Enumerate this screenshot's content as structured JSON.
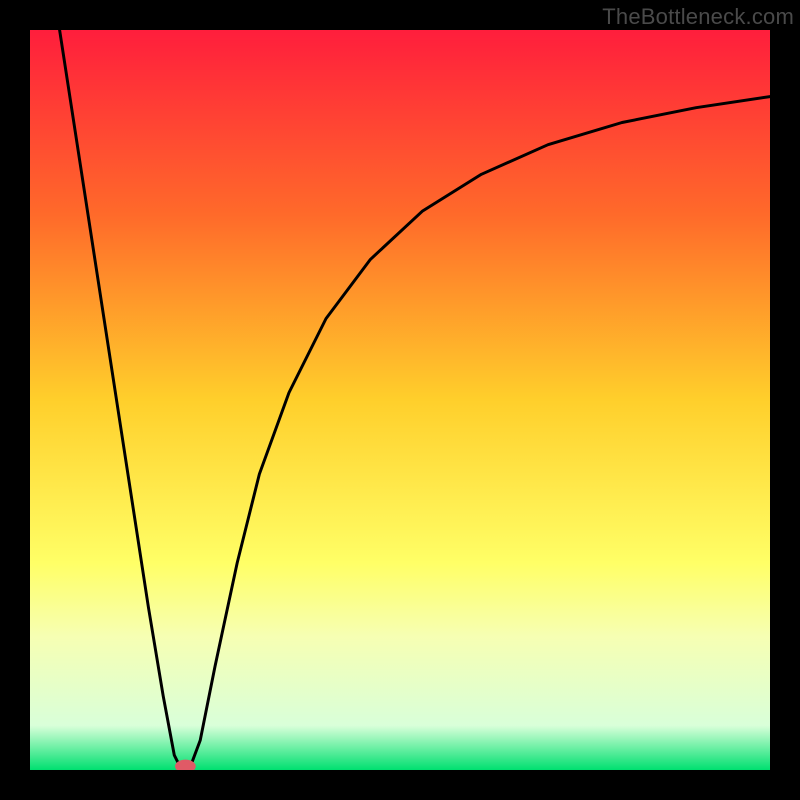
{
  "watermark": "TheBottleneck.com",
  "chart_data": {
    "type": "line",
    "title": "",
    "xlabel": "",
    "ylabel": "",
    "xlim": [
      0,
      100
    ],
    "ylim": [
      0,
      100
    ],
    "gradient_stops": [
      {
        "offset": 0.0,
        "color": "#ff1e3c"
      },
      {
        "offset": 0.25,
        "color": "#ff6a2a"
      },
      {
        "offset": 0.5,
        "color": "#ffcf2b"
      },
      {
        "offset": 0.72,
        "color": "#ffff66"
      },
      {
        "offset": 0.82,
        "color": "#f6ffb3"
      },
      {
        "offset": 0.94,
        "color": "#d9ffd9"
      },
      {
        "offset": 1.0,
        "color": "#00e070"
      }
    ],
    "curve": [
      {
        "x": 4.0,
        "y": 100.0
      },
      {
        "x": 6.0,
        "y": 87.0
      },
      {
        "x": 8.0,
        "y": 74.0
      },
      {
        "x": 10.0,
        "y": 61.0
      },
      {
        "x": 12.0,
        "y": 48.0
      },
      {
        "x": 14.0,
        "y": 35.0
      },
      {
        "x": 16.0,
        "y": 22.0
      },
      {
        "x": 18.0,
        "y": 10.0
      },
      {
        "x": 19.5,
        "y": 2.0
      },
      {
        "x": 20.5,
        "y": 0.0
      },
      {
        "x": 21.5,
        "y": 0.0
      },
      {
        "x": 23.0,
        "y": 4.0
      },
      {
        "x": 25.0,
        "y": 14.0
      },
      {
        "x": 28.0,
        "y": 28.0
      },
      {
        "x": 31.0,
        "y": 40.0
      },
      {
        "x": 35.0,
        "y": 51.0
      },
      {
        "x": 40.0,
        "y": 61.0
      },
      {
        "x": 46.0,
        "y": 69.0
      },
      {
        "x": 53.0,
        "y": 75.5
      },
      {
        "x": 61.0,
        "y": 80.5
      },
      {
        "x": 70.0,
        "y": 84.5
      },
      {
        "x": 80.0,
        "y": 87.5
      },
      {
        "x": 90.0,
        "y": 89.5
      },
      {
        "x": 100.0,
        "y": 91.0
      }
    ],
    "marker": {
      "x": 21.0,
      "y": 0.5,
      "rx": 1.4,
      "ry": 0.9,
      "color": "#e05a66"
    }
  }
}
